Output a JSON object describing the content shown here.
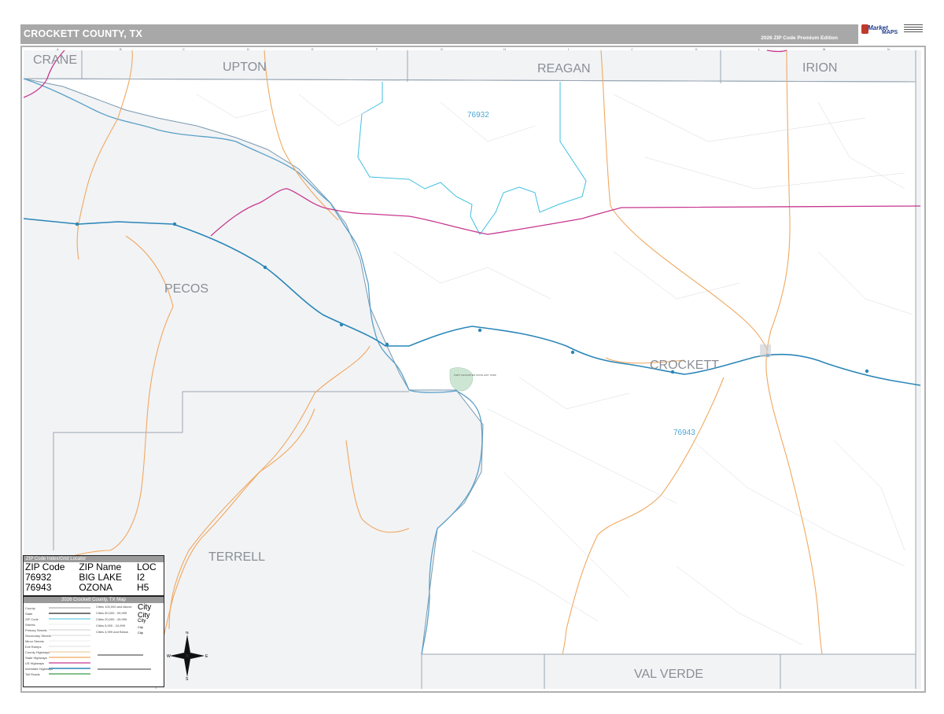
{
  "header": {
    "title": "CROCKETT COUNTY, TX",
    "edition": "2026 ZIP Code Premium Edition",
    "logo": {
      "word1": "Market",
      "word2": "MAPS"
    }
  },
  "counties": {
    "crane": "CRANE",
    "upton": "UPTON",
    "reagan": "REAGAN",
    "irion": "IRION",
    "pecos": "PECOS",
    "crockett": "CROCKETT",
    "terrell": "TERRELL",
    "val_verde": "VAL VERDE"
  },
  "zip_labels": {
    "zip1": "76932",
    "zip2": "76943"
  },
  "zip_index": {
    "header": "ZIP Code Index/Grid Locator",
    "columns": [
      "ZIP Code",
      "ZIP Name",
      "LOC"
    ],
    "rows": [
      [
        "76932",
        "BIG LAKE",
        "I2"
      ],
      [
        "76943",
        "OZONA",
        "H5"
      ]
    ]
  },
  "map_key": {
    "header": "2026 Crockett County, TX Map",
    "items": [
      "County",
      "State",
      "ZIP Code",
      "Streets",
      "Primary Streets",
      "Secondary Streets",
      "Minor Streets",
      "Exit Ramps",
      "County Highways",
      "State Highways",
      "US Highways",
      "Interstate Highways",
      "Toll Roads"
    ],
    "city_sizes": [
      "Cities 100,000 and Above",
      "Cities 50,000 - 99,999",
      "Cities 20,000 - 49,999",
      "Cities 5,000 - 24,999",
      "Cities 4,999 and Below"
    ],
    "city_samples": [
      "City",
      "City",
      "City",
      "City",
      "City"
    ],
    "compass": {
      "n": "N",
      "s": "S",
      "e": "E",
      "w": "W"
    }
  },
  "colors": {
    "county_fill": "#f2f3f5",
    "crockett_fill": "#ffffff",
    "county_border": "#7a9ab0",
    "zip_border": "#3fc1e0",
    "zip_label": "#4aa8d8",
    "interstate": "#2a86b8",
    "us_highway": "#c7378f",
    "state_highway": "#f0a860",
    "river": "#5aa0c8",
    "park": "#cde6d4"
  },
  "park_label": "FORT LANCASTER STATE HIST. PARK"
}
